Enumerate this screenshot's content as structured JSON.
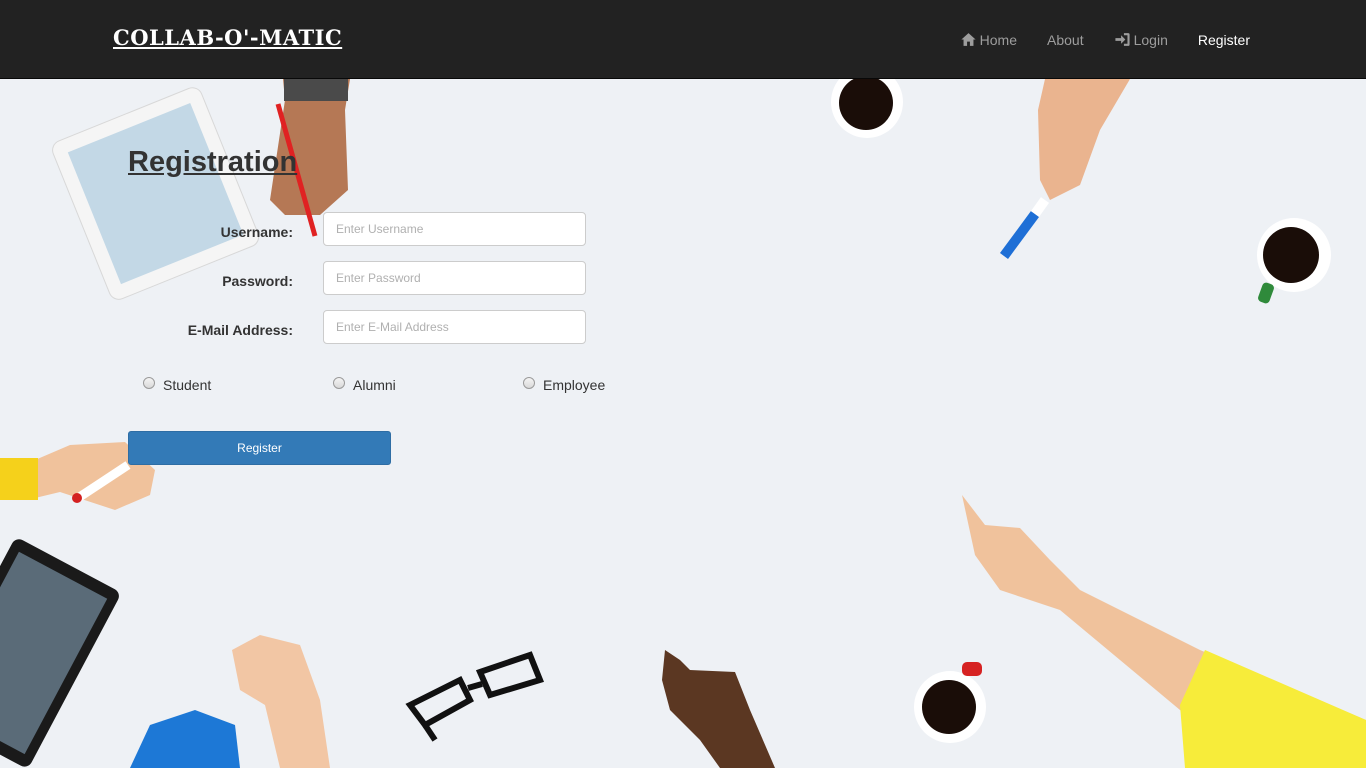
{
  "navbar": {
    "brand": "COLLAB-O'-MATIC",
    "items": [
      {
        "label": "Home",
        "icon": "home-icon"
      },
      {
        "label": "About"
      },
      {
        "label": "Login",
        "icon": "login-icon"
      },
      {
        "label": "Register",
        "active": true
      }
    ]
  },
  "form": {
    "title": "Registration",
    "username_label": "Username:",
    "username_placeholder": "Enter Username",
    "password_label": "Password:",
    "password_placeholder": "Enter Password",
    "email_label": "E-Mail Address:",
    "email_placeholder": "Enter E-Mail Address",
    "roles": [
      "Student",
      "Alumni",
      "Employee"
    ],
    "submit_label": "Register"
  },
  "colors": {
    "navbar_bg": "#222222",
    "button_primary": "#337ab7",
    "page_bg": "#eef1f5"
  }
}
